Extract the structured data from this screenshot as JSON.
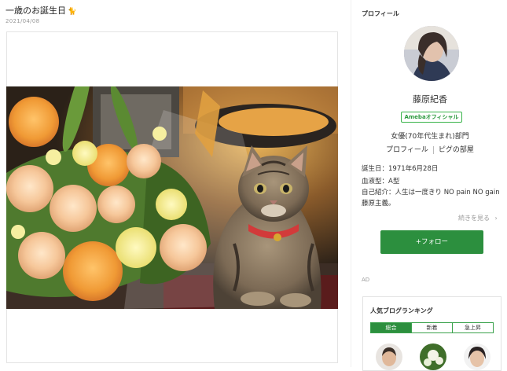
{
  "post": {
    "title": "一歳のお誕生日",
    "title_icon": "🐈",
    "date": "2021/04/08"
  },
  "profile": {
    "heading": "プロフィール",
    "name": "藤原紀香",
    "badge": "Amebaオフィシャル",
    "genre": "女優(70年代生まれ)部門",
    "link_profile": "プロフィール",
    "link_room": "ピグの部屋",
    "birthday": "誕生日：1971年6月28日",
    "blood": "血液型：A型",
    "intro": "自己紹介：人生は一度きり NO pain NO gain",
    "intro2": "藤原主義。",
    "more": "続きを見る",
    "more_icon": "chevron-right-icon",
    "follow_label": "フォロー",
    "follow_icon": "plus-icon"
  },
  "ad_label": "AD",
  "ranking": {
    "title": "人気ブログランキング",
    "tabs": [
      "総合",
      "新着",
      "急上昇"
    ]
  },
  "colors": {
    "accent_green": "#2c8f3e",
    "badge_green": "#39b44a"
  }
}
